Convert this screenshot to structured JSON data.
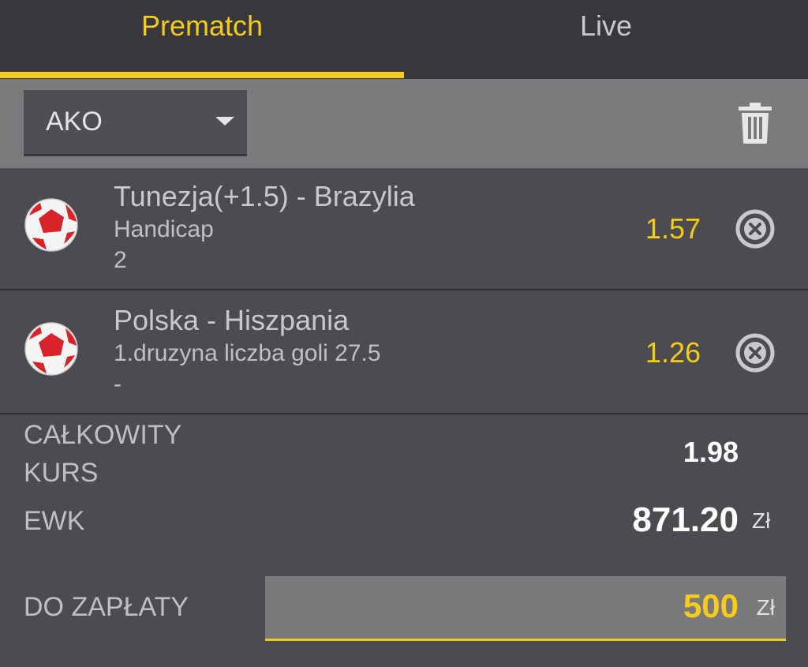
{
  "tabs": {
    "prematch": "Prematch",
    "live": "Live",
    "active": "prematch"
  },
  "toolbar": {
    "bet_type": "AKO",
    "trash_icon": "trash-icon"
  },
  "bets": [
    {
      "match": "Tunezja(+1.5) - Brazylia",
      "market": "Handicap",
      "pick": "2",
      "odds": "1.57"
    },
    {
      "match": "Polska - Hiszpania",
      "market": "1.druzyna liczba goli 27.5",
      "pick": "-",
      "odds": "1.26"
    }
  ],
  "summary": {
    "total_odds_label_line1": "CAŁKOWITY",
    "total_odds_label_line2": "KURS",
    "total_odds": "1.98",
    "ewk_label": "EWK",
    "ewk_value": "871.20",
    "ewk_currency": "Zł",
    "to_pay_label": "DO ZAPŁATY",
    "stake": "500",
    "stake_currency": "Zł"
  },
  "colors": {
    "accent": "#f5cc1c",
    "tab_bg": "#38383c",
    "toolbar_bg": "#7b7b7e",
    "row_bg": "#4b4b50"
  }
}
